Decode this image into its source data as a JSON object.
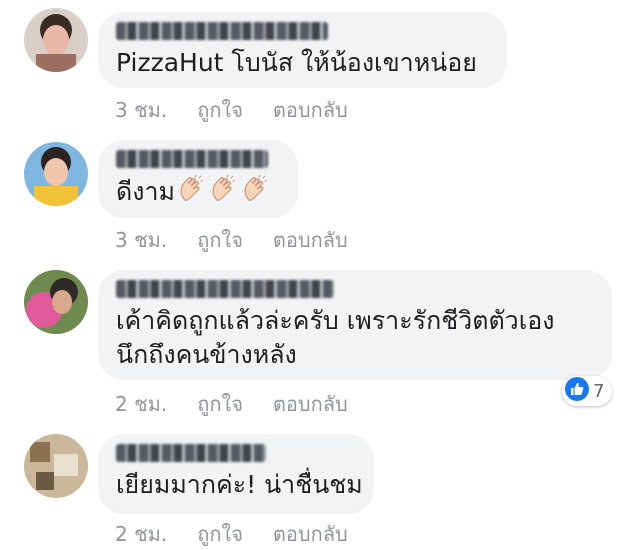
{
  "comments": [
    {
      "text": "PizzaHut  โบนัส ให้น้องเขาหน่อย",
      "time": "3 ชม.",
      "like": "ถูกใจ",
      "reply": "ตอบกลับ"
    },
    {
      "text": "ดีงาม",
      "icons": [
        "clapping-hands-icon",
        "clapping-hands-icon",
        "clapping-hands-icon"
      ],
      "time": "3 ชม.",
      "like": "ถูกใจ",
      "reply": "ตอบกลับ"
    },
    {
      "line1": "เค้าคิดถูกแล้วล่ะครับ เพราะรักชีวิตตัวเอง",
      "line2": "นึกถึงคนข้างหลัง",
      "reactions": {
        "icon": "thumbs-up-icon",
        "count": "7",
        "color": "#1877f2"
      },
      "time": "2 ชม.",
      "like": "ถูกใจ",
      "reply": "ตอบกลับ"
    },
    {
      "text": "เยียมมากค่ะ! น่าชื่นชม",
      "time": "2 ชม.",
      "like": "ถูกใจ",
      "reply": "ตอบกลับ"
    }
  ],
  "colors": {
    "bubble": "#f2f3f5",
    "action_text": "#90949c",
    "comment_text": "#1c1e21"
  }
}
